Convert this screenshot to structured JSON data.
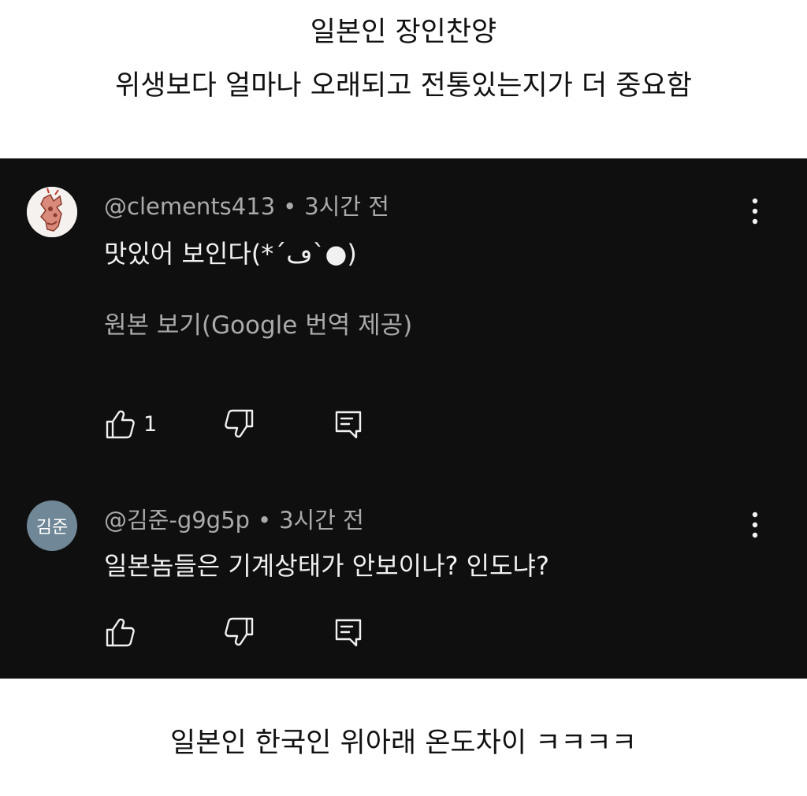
{
  "captions": {
    "top_line1": "일본인 장인찬양",
    "top_line2": "위생보다 얼마나 오래되고 전통있는지가 더 중요함",
    "bottom": "일본인 한국인 위아래 온도차이 ㅋㅋㅋㅋ"
  },
  "comments": [
    {
      "author": "@clements413",
      "separator": "•",
      "time": "3시간 전",
      "text": "맛있어 보인다(*´ڡ`●)",
      "translate_link": "원본 보기(Google 번역 제공)",
      "like_count": "1",
      "avatar": {
        "type": "image",
        "icon": "cartoon-avatar-icon"
      }
    },
    {
      "author": "@김준-g9g5p",
      "separator": "•",
      "time": "3시간 전",
      "text": "일본놈들은 기계상태가 안보이나? 인도냐?",
      "avatar": {
        "type": "initials",
        "initials": "김준",
        "color": "#6f8796"
      }
    }
  ],
  "colors": {
    "panel_bg": "#0f0f0f",
    "primary_text": "#f1f1f1",
    "secondary_text": "#aaaaaa"
  }
}
